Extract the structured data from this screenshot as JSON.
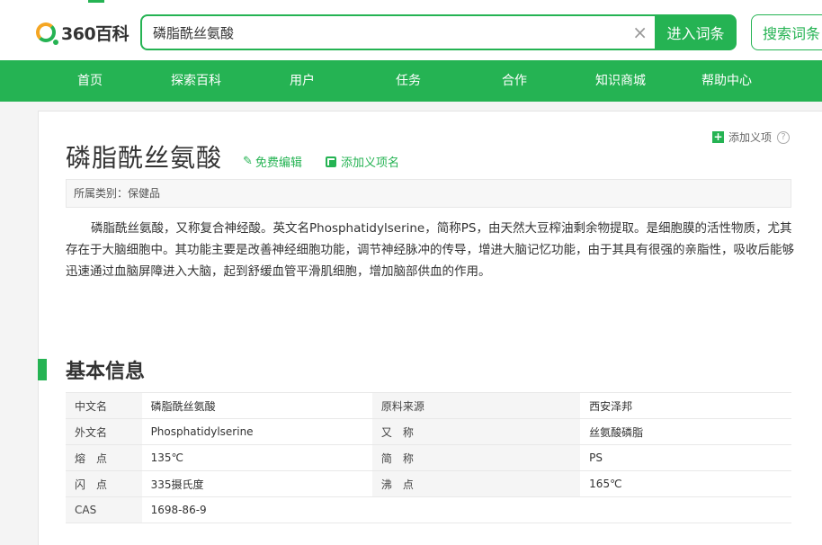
{
  "header": {
    "logo_text": "360百科",
    "search_value": "磷脂酰丝氨酸",
    "clear_symbol": "×",
    "enter_button": "进入词条",
    "search_button": "搜索词条"
  },
  "nav": {
    "items": [
      "首页",
      "探索百科",
      "用户",
      "任务",
      "合作",
      "知识商城",
      "帮助中心"
    ]
  },
  "entry": {
    "add_meaning": "添加义项",
    "help_symbol": "?",
    "title": "磷脂酰丝氨酸",
    "edit_label": "免费编辑",
    "add_term_label": "添加义项名",
    "category": "所属类别：保健品",
    "summary": "磷脂酰丝氨酸，又称复合神经酸。英文名Phosphatidylserine，简称PS，由天然大豆榨油剩余物提取。是细胞膜的活性物质，尤其存在于大脑细胞中。其功能主要是改善神经细胞功能，调节神经脉冲的传导，增进大脑记忆功能，由于其具有很强的亲脂性，吸收后能够迅速通过血脑屏障进入大脑，起到舒缓血管平滑肌细胞，增加脑部供血的作用。"
  },
  "basic_info": {
    "title": "基本信息",
    "rows": [
      {
        "k1": "中文名",
        "v1": "磷脂酰丝氨酸",
        "k2": "原料来源",
        "v2": "西安泽邦"
      },
      {
        "k1": "外文名",
        "v1": "Phosphatidylserine",
        "k2": "又　称",
        "v2": "丝氨酸磷脂"
      },
      {
        "k1": "熔　点",
        "v1": "135℃",
        "k2": "简　称",
        "v2": "PS"
      },
      {
        "k1": "闪　点",
        "v1": "335摄氏度",
        "k2": "沸　点",
        "v2": "165℃"
      },
      {
        "k1": "CAS",
        "v1": "1698-86-9",
        "k2": "",
        "v2": ""
      }
    ]
  },
  "colors": {
    "brand_green": "#25b353",
    "logo_orange": "#f5a623"
  }
}
